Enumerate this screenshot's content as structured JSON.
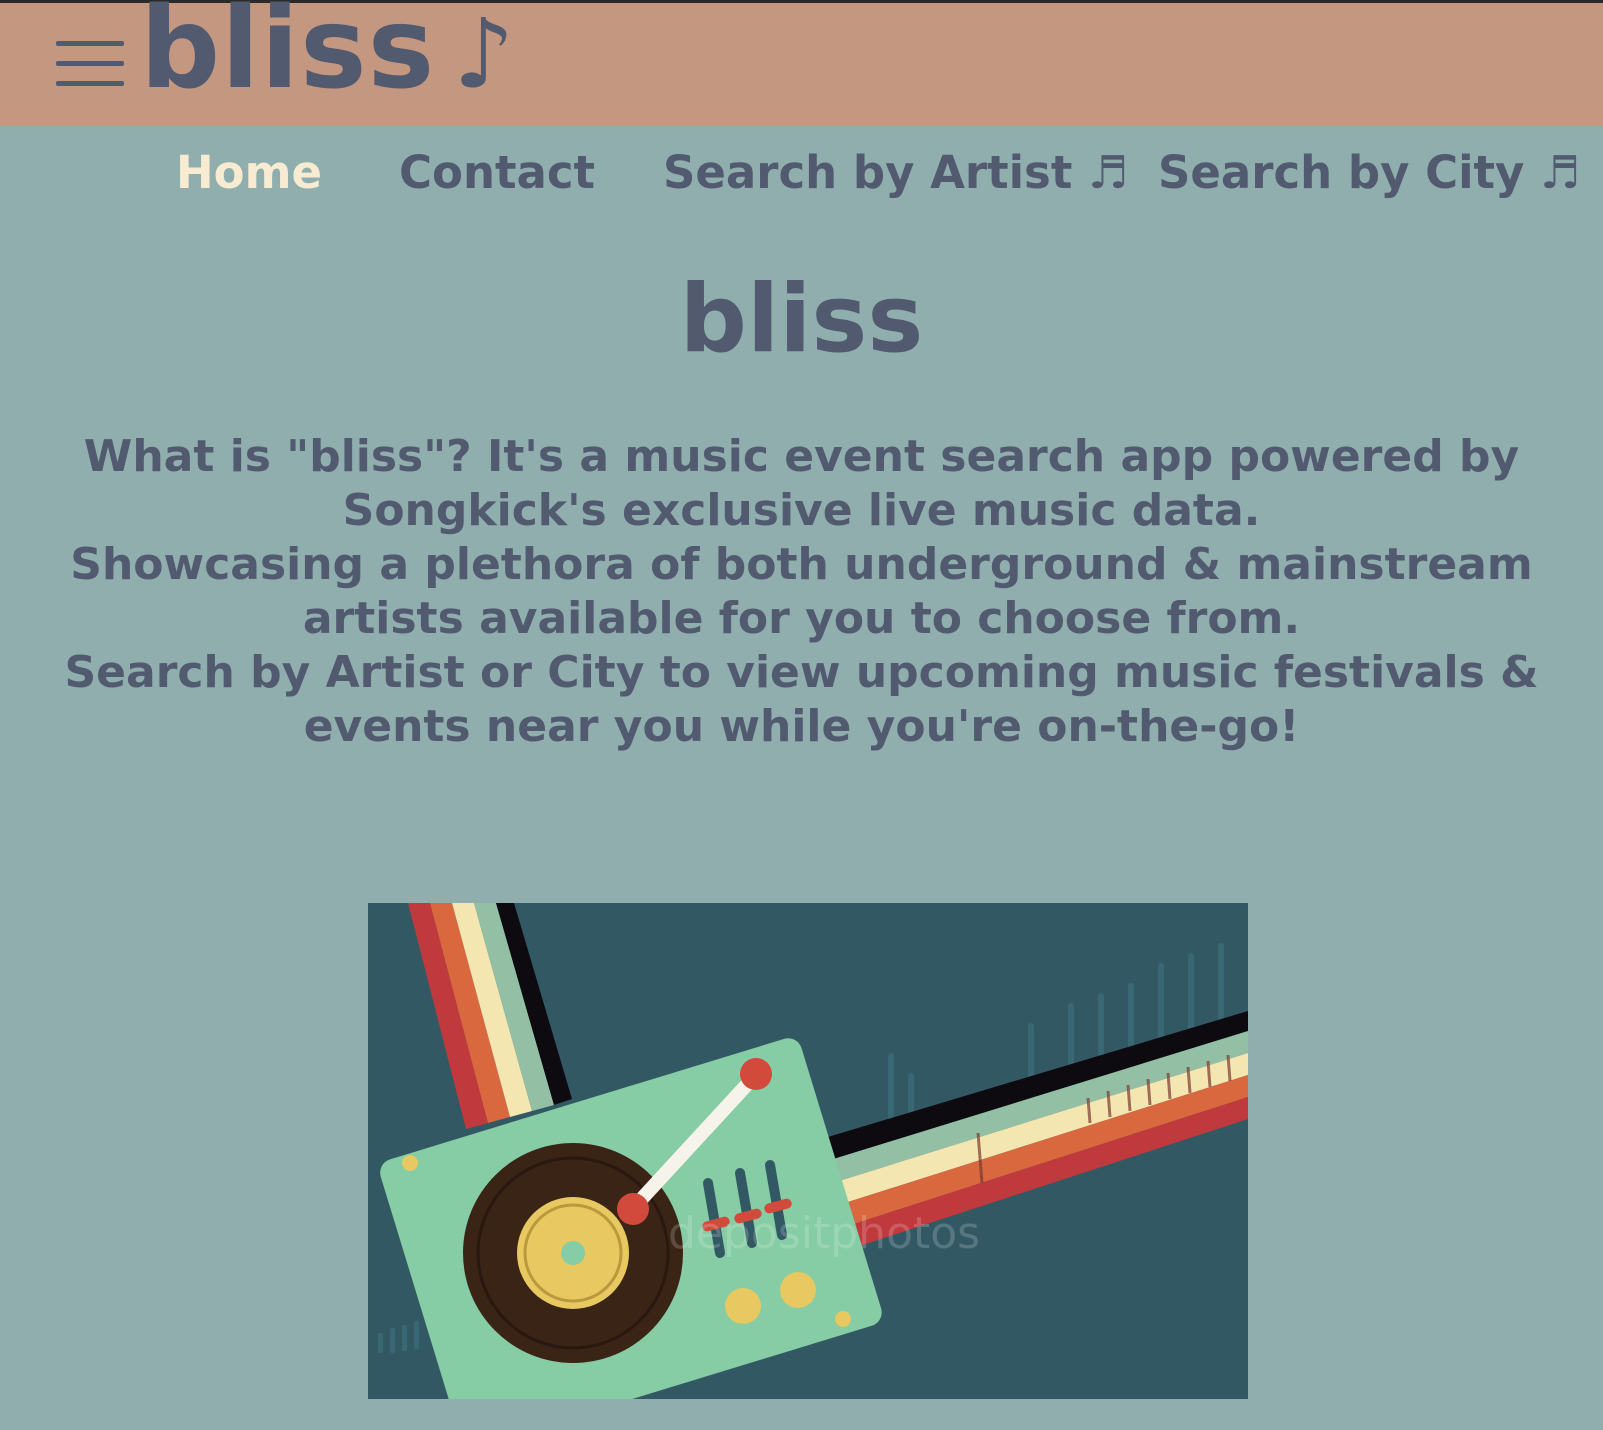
{
  "header": {
    "menu_icon": "hamburger-menu-icon",
    "brand": "bliss",
    "brand_icon": "music-note-icon",
    "brand_note": "♪"
  },
  "nav": {
    "items": [
      {
        "label": "Home",
        "active": true
      },
      {
        "label": "Contact",
        "active": false
      },
      {
        "label": "Search by Artist ♬",
        "active": false
      },
      {
        "label": "Search by City ♬",
        "active": false
      }
    ]
  },
  "main": {
    "title": "bliss",
    "paragraphs": [
      "What is \"bliss\"? It's a music event search app powered by Songkick's exclusive live music data.",
      "Showcasing a plethora of both underground & mainstream artists available for you to choose from.",
      "Search by Artist or City to view upcoming music festivals & events near you while you're on-the-go!"
    ],
    "hero_image": {
      "icon": "turntable-illustration",
      "watermark": "depositphotos"
    }
  },
  "colors": {
    "page_bg": "#8faead",
    "header_bg": "#c49781",
    "text": "#525a70",
    "active_nav": "#f7ecd2",
    "image_bg": "#325864",
    "turntable": "#86cca4",
    "record": "#3a2416",
    "label_yellow": "#e8c860",
    "stripe_red": "#c0393d",
    "stripe_orange": "#d9683f",
    "stripe_cream": "#f4e6b0",
    "stripe_mint": "#93c0a4"
  }
}
